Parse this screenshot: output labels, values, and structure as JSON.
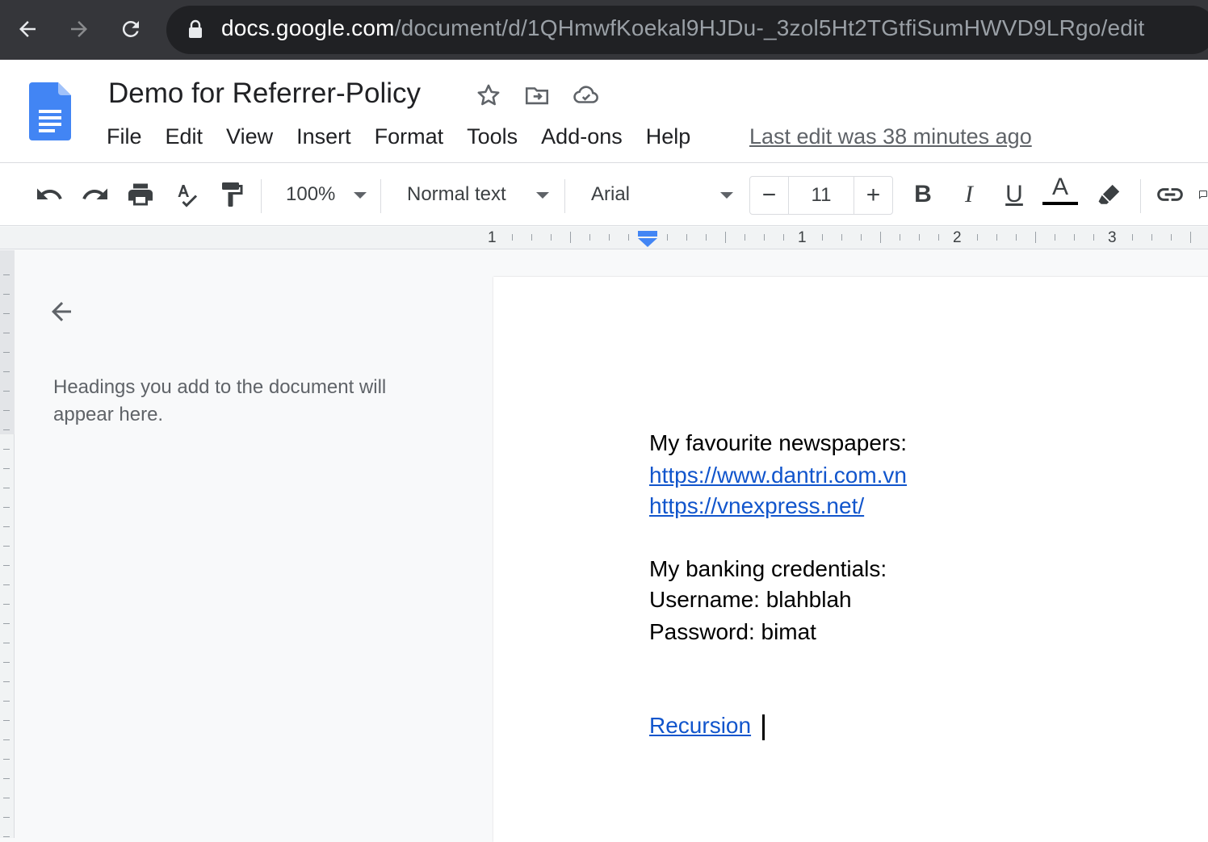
{
  "browser": {
    "url_host": "docs.google.com",
    "url_path": "/document/d/1QHmwfKoekal9HJDu-_3zol5Ht2TGtfiSumHWVD9LRgo/edit"
  },
  "header": {
    "doc_title": "Demo for Referrer-Policy",
    "menu": [
      "File",
      "Edit",
      "View",
      "Insert",
      "Format",
      "Tools",
      "Add-ons",
      "Help"
    ],
    "last_edit": "Last edit was 38 minutes ago"
  },
  "toolbar": {
    "zoom": "100%",
    "style": "Normal text",
    "font": "Arial",
    "font_size": "11",
    "minus": "−",
    "plus": "+",
    "bold": "B",
    "italic": "I",
    "underline": "U",
    "text_color": "A",
    "text_color_hex": "#000000"
  },
  "ruler": {
    "labels": [
      "1",
      "1",
      "2",
      "3"
    ]
  },
  "outline": {
    "empty_message": "Headings you add to the document will appear here."
  },
  "document": {
    "lines": [
      {
        "text": "My favourite newspapers:",
        "link": false
      },
      {
        "text": "https://www.dantri.com.vn",
        "link": true
      },
      {
        "text": "https://vnexpress.net/",
        "link": true
      },
      {
        "text": "My banking credentials:",
        "link": false
      },
      {
        "text": "Username: blahblah",
        "link": false
      },
      {
        "text": "Password: bimat",
        "link": false
      },
      {
        "text": "Recursion",
        "link": true
      }
    ],
    "link_color": "#1155cc"
  },
  "colors": {
    "chrome_bg": "#35363a",
    "omnibox_bg": "#202124",
    "docs_blue": "#4285f4"
  }
}
